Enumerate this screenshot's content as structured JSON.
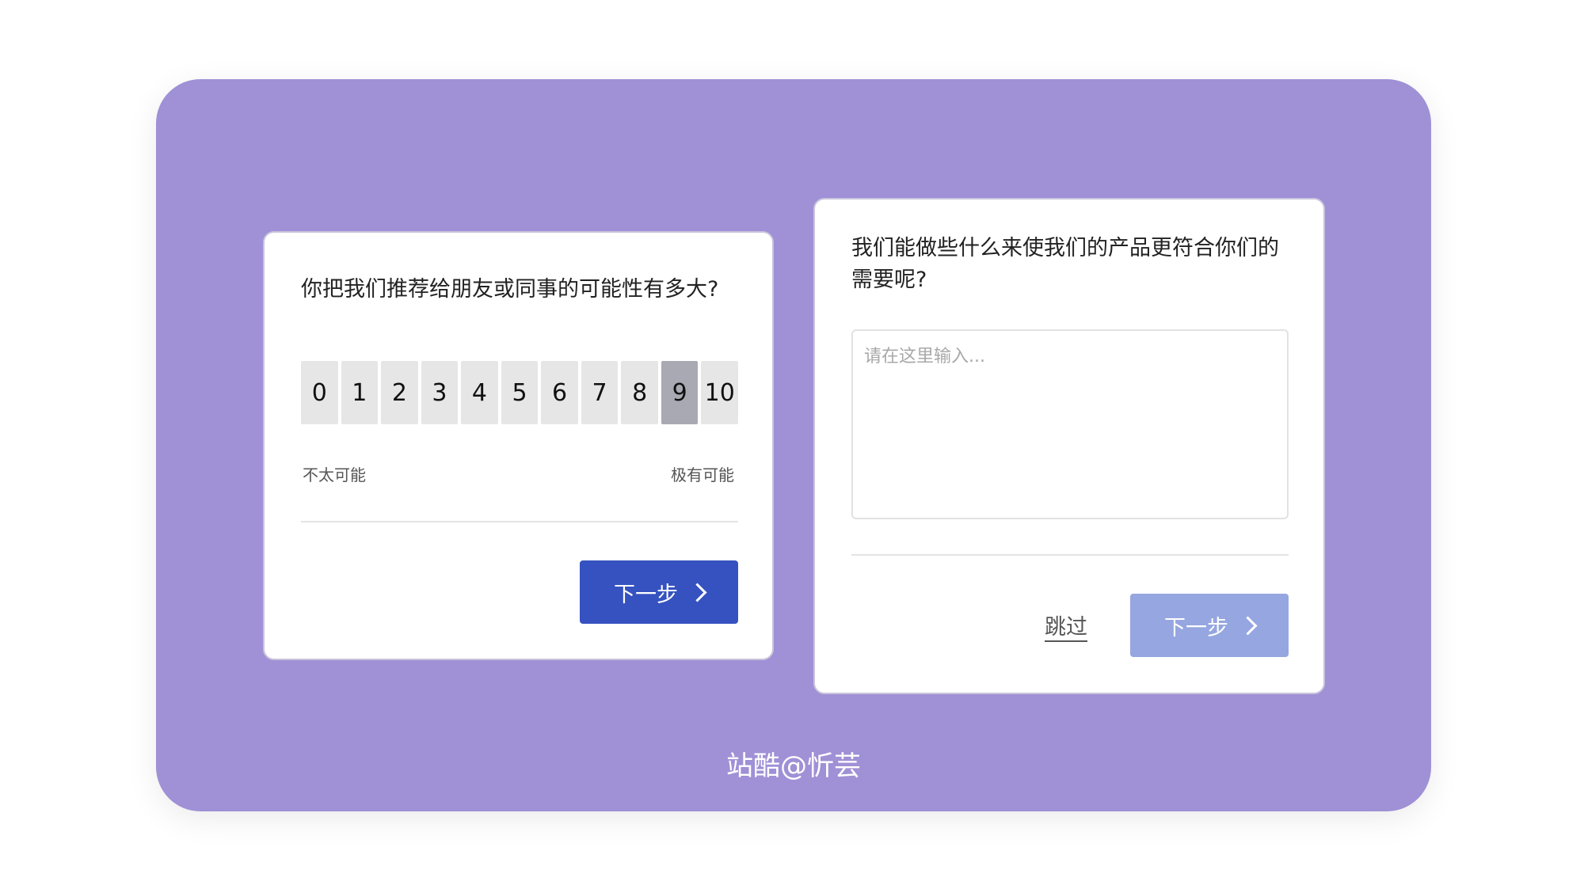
{
  "nps_card": {
    "question": "你把我们推荐给朋友或同事的可能性有多大?",
    "scale": [
      "0",
      "1",
      "2",
      "3",
      "4",
      "5",
      "6",
      "7",
      "8",
      "9",
      "10"
    ],
    "selected_index": 9,
    "low_label": "不太可能",
    "high_label": "极有可能",
    "next_label": "下一步"
  },
  "feedback_card": {
    "question": "我们能做些什么来使我们的产品更符合你们的需要呢?",
    "placeholder": "请在这里输入...",
    "skip_label": "跳过",
    "next_label": "下一步"
  },
  "watermark": "站酷@忻芸",
  "colors": {
    "panel_bg": "#a090d6",
    "primary": "#3552c0",
    "primary_disabled": "#95a6e0",
    "selected_cell": "#a9a9b3"
  }
}
